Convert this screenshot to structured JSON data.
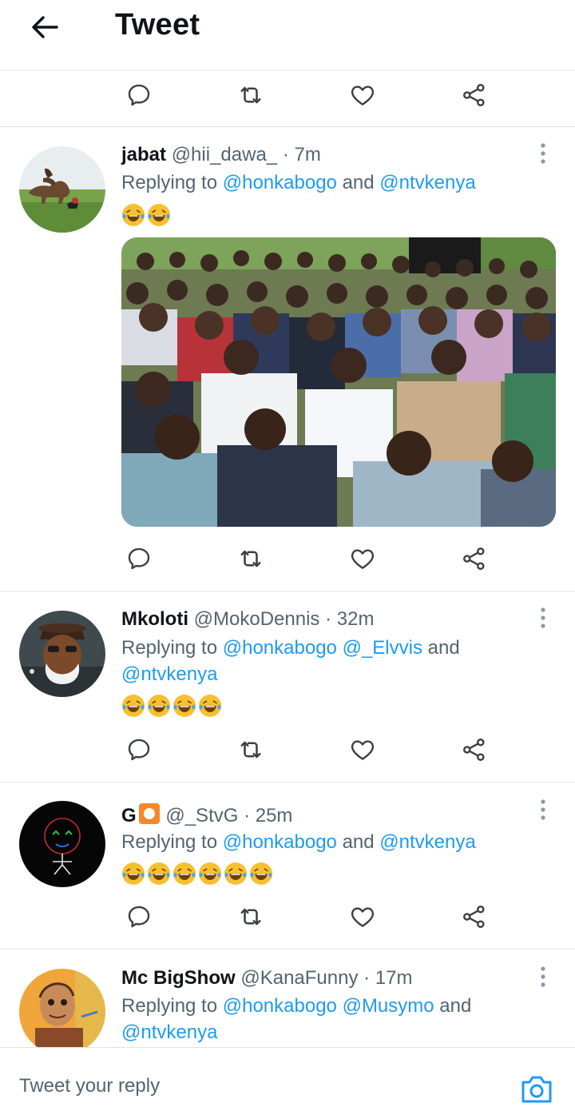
{
  "header": {
    "title": "Tweet",
    "back_icon": "arrow-left-icon"
  },
  "actions": {
    "reply_icon": "comment-icon",
    "retweet_icon": "retweet-icon",
    "like_icon": "heart-icon",
    "share_icon": "share-icon"
  },
  "colors": {
    "link": "#1d9bf0",
    "text": "#0f1419",
    "muted": "#536471",
    "divider": "#e1e5e8"
  },
  "tweets": [
    {
      "name": "jabat",
      "handle": "@hii_dawa_",
      "time": "· 7m",
      "replying_prefix": "Replying to ",
      "mentions": [
        "@honkabogo",
        "@ntvkenya"
      ],
      "conjunction": " and ",
      "emoji": "😂😂"
    },
    {
      "name": "Mkoloti",
      "handle": "@MokoDennis",
      "time": "· 32m",
      "replying_prefix": "Replying to ",
      "mentions": [
        "@honkabogo",
        "@_Elvvis",
        "@ntvkenya"
      ],
      "conjunction": " and ",
      "emoji": "😂😂😂😂"
    },
    {
      "name": "G",
      "handle": "@_StvG",
      "time": "· 25m",
      "replying_prefix": "Replying to ",
      "mentions": [
        "@honkabogo",
        "@ntvkenya"
      ],
      "conjunction": " and ",
      "emoji": "😂😂😂😂😂😂"
    },
    {
      "name": "Mc BigShow",
      "handle": "@KanaFunny",
      "time": "· 17m",
      "replying_prefix": "Replying to ",
      "mentions": [
        "@honkabogo",
        "@Musymo",
        "@ntvkenya"
      ],
      "conjunction": " and "
    }
  ],
  "composer": {
    "placeholder": "Tweet your reply",
    "camera_icon": "camera-icon"
  }
}
